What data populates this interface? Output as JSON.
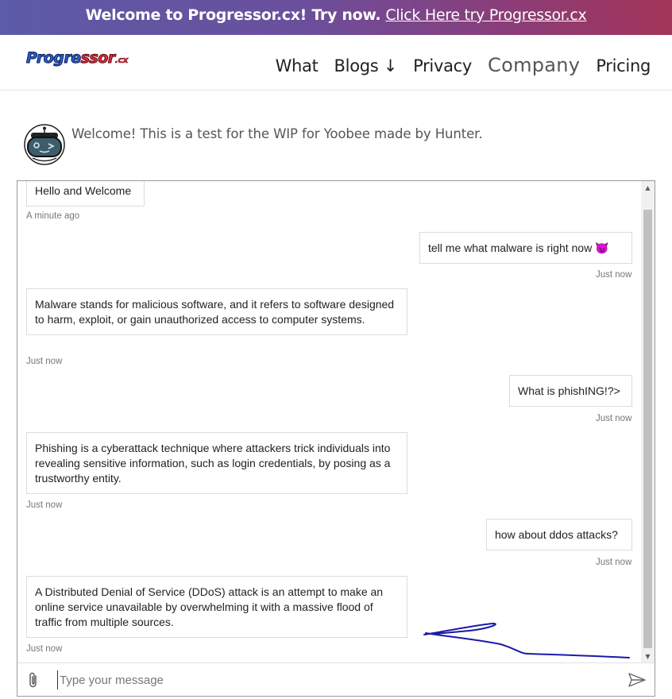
{
  "banner": {
    "text": "Welcome to Progressor.cx! Try now.",
    "link": "Click Here try Progressor.cx"
  },
  "logo": {
    "part1": "Progre",
    "part2": "ssor",
    "part3": ".cx"
  },
  "nav": {
    "items": [
      "What",
      "Blogs ↓",
      "Privacy",
      "Company",
      "Pricing"
    ]
  },
  "welcome": {
    "text": "Welcome! This is a test for the WIP for Yoobee made by Hunter."
  },
  "chat": {
    "messages": [
      {
        "sender": "bot",
        "text": "Hello and Welcome",
        "time": "A minute ago"
      },
      {
        "sender": "user",
        "text": "tell me what malware is right now",
        "emoji": "😈",
        "time": "Just now"
      },
      {
        "sender": "bot",
        "text": "Malware stands for malicious software, and it refers to software designed to harm, exploit, or gain unauthorized access to computer systems.",
        "time": "Just now"
      },
      {
        "sender": "user",
        "text": "What is phishING!?>",
        "time": "Just now"
      },
      {
        "sender": "bot",
        "text": "Phishing is a cyberattack technique where attackers trick individuals into revealing sensitive information, such as login credentials, by posing as a trustworthy entity.",
        "time": "Just now"
      },
      {
        "sender": "user",
        "text": "how about ddos attacks?",
        "time": "Just now"
      },
      {
        "sender": "bot",
        "text": "A Distributed Denial of Service (DDoS) attack is an attempt to make an online service unavailable by overwhelming it with a massive flood of traffic from multiple sources.",
        "time": "Just now"
      }
    ],
    "input_placeholder": "Type your message"
  },
  "colors": {
    "banner_left": "#5b5ba8",
    "banner_right": "#a33458",
    "scribble": "#1a1aa8"
  },
  "icons": [
    "attach-icon",
    "send-icon",
    "robot-avatar-icon",
    "scroll-up-arrow-icon",
    "scroll-down-arrow-icon"
  ]
}
